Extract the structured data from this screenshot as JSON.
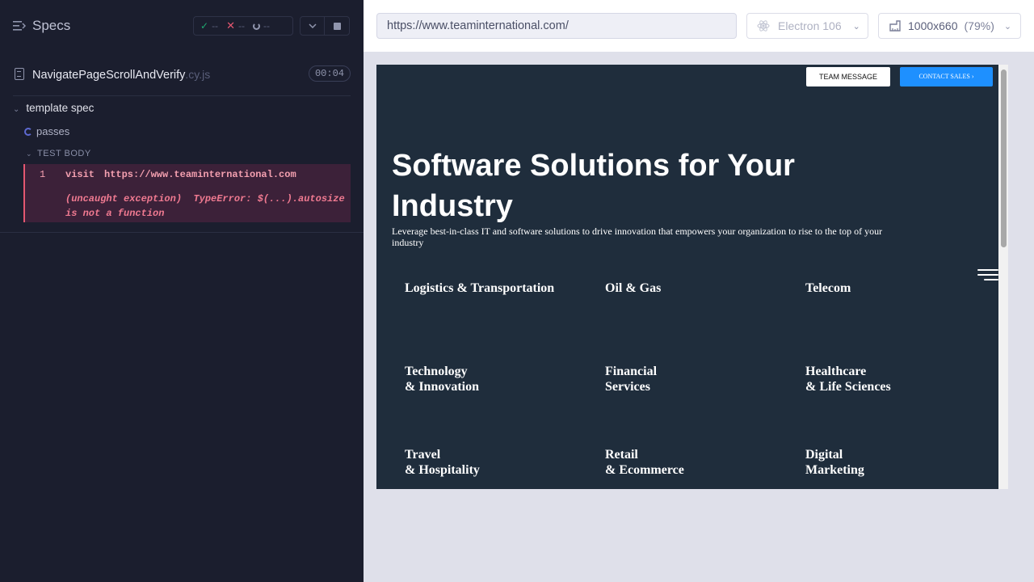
{
  "sidebar": {
    "title": "Specs",
    "stats": {
      "passed": "--",
      "failed": "--",
      "pending": "--"
    },
    "spec": {
      "name": "NavigatePageScrollAndVerify",
      "ext": ".cy.js",
      "duration": "00:04"
    },
    "suite": "template spec",
    "test": "passes",
    "section": "TEST BODY",
    "command": {
      "number": "1",
      "name": "visit",
      "arg": "https://www.teaminternational.com",
      "error": "(uncaught exception)  TypeError: $(...).autosize\nis not a function"
    }
  },
  "toolbar": {
    "url": "https://www.teaminternational.com/",
    "browser": "Electron 106",
    "viewport": "1000x660",
    "zoom": "(79%)"
  },
  "aut": {
    "btn_message": "TEAM MESSAGE",
    "btn_sales": "CONTACT SALES ›",
    "hero_title": "Software Solutions for Your Industry",
    "hero_sub": "Leverage best-in-class IT and software solutions to drive innovation that empowers your organization to rise to the top of your industry",
    "industries": [
      "Logistics & Transportation",
      "Oil & Gas",
      "Telecom",
      "Technology\n& Innovation",
      "Financial\nServices",
      "Healthcare\n& Life Sciences",
      "Travel\n& Hospitality",
      "Retail\n& Ecommerce",
      "Digital\nMarketing"
    ]
  },
  "colors": {
    "sidebar_bg": "#1b1e2e",
    "error_bg": "#3c2139",
    "error_text": "#f07a91",
    "aut_bg": "#1f2d3c",
    "accent_blue": "#1e90ff"
  }
}
